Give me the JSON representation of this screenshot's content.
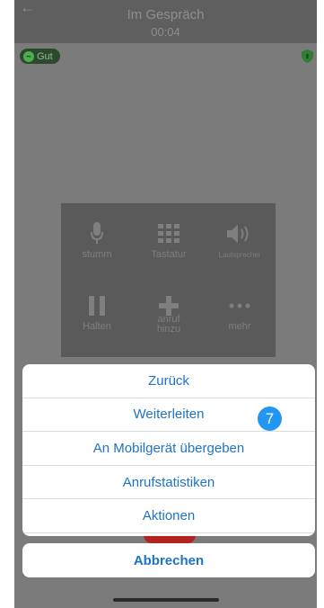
{
  "header": {
    "title": "Im Gespräch",
    "timer": "00:04"
  },
  "quality": {
    "label": "Gut"
  },
  "controls": [
    {
      "id": "mute",
      "label": "stumm"
    },
    {
      "id": "keypad",
      "label": "Tastatur"
    },
    {
      "id": "speaker",
      "label": "Lautsprecher"
    },
    {
      "id": "hold",
      "label": "Halten"
    },
    {
      "id": "add-call",
      "label": "anruf\nhinzu"
    },
    {
      "id": "more",
      "label": "mehr"
    }
  ],
  "action_sheet": {
    "items": [
      {
        "label": "Zurück"
      },
      {
        "label": "Weiterleiten"
      },
      {
        "label": "An Mobilgerät übergeben"
      },
      {
        "label": "Anrufstatistiken"
      },
      {
        "label": "Aktionen"
      }
    ],
    "cancel_label": "Abbrechen",
    "step_badge": "7"
  },
  "colors": {
    "accent": "#1e73c9",
    "badge": "#2196f3",
    "end_call": "#b52222",
    "quality_ok": "#4caf50"
  }
}
